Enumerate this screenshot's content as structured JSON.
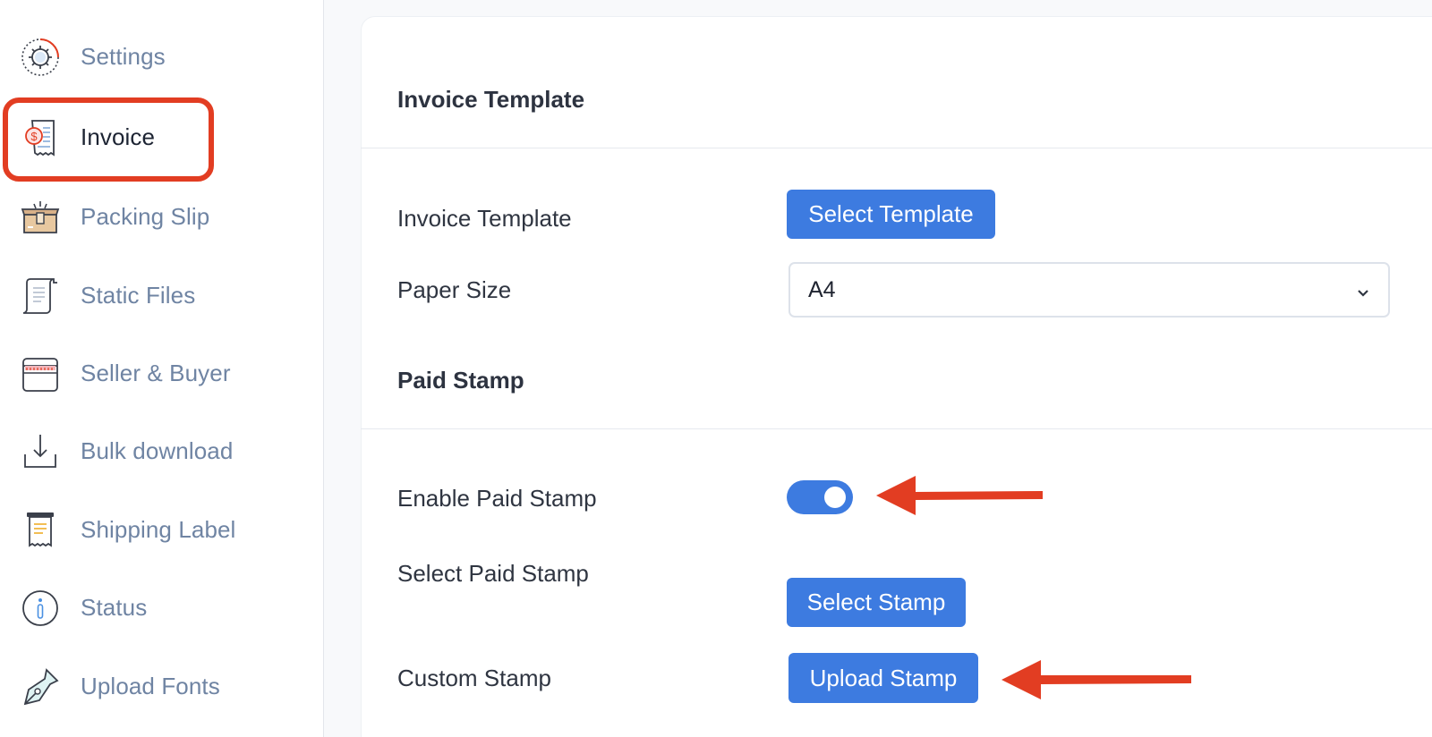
{
  "sidebar": {
    "items": [
      {
        "label": "Settings",
        "icon": "settings-gear-icon"
      },
      {
        "label": "Invoice",
        "icon": "invoice-receipt-icon",
        "active": true
      },
      {
        "label": "Packing Slip",
        "icon": "packing-box-icon"
      },
      {
        "label": "Static Files",
        "icon": "scroll-document-icon"
      },
      {
        "label": "Seller & Buyer",
        "icon": "storefront-icon"
      },
      {
        "label": "Bulk download",
        "icon": "download-tray-icon"
      },
      {
        "label": "Shipping Label",
        "icon": "shipping-label-icon"
      },
      {
        "label": "Status",
        "icon": "info-circle-icon"
      },
      {
        "label": "Upload Fonts",
        "icon": "pen-nib-icon"
      }
    ]
  },
  "main": {
    "invoice_section": {
      "title": "Invoice Template",
      "template_label": "Invoice Template",
      "select_template_button": "Select Template",
      "paper_size_label": "Paper Size",
      "paper_size_value": "A4"
    },
    "paid_stamp_section": {
      "title": "Paid Stamp",
      "enable_label": "Enable Paid Stamp",
      "enable_on": true,
      "select_label": "Select Paid Stamp",
      "select_stamp_button": "Select Stamp",
      "custom_label": "Custom Stamp",
      "upload_stamp_button": "Upload Stamp"
    }
  },
  "colors": {
    "accent": "#3d7be0",
    "annotation": "#e23d22",
    "sidebar_text": "#6f84a3"
  }
}
